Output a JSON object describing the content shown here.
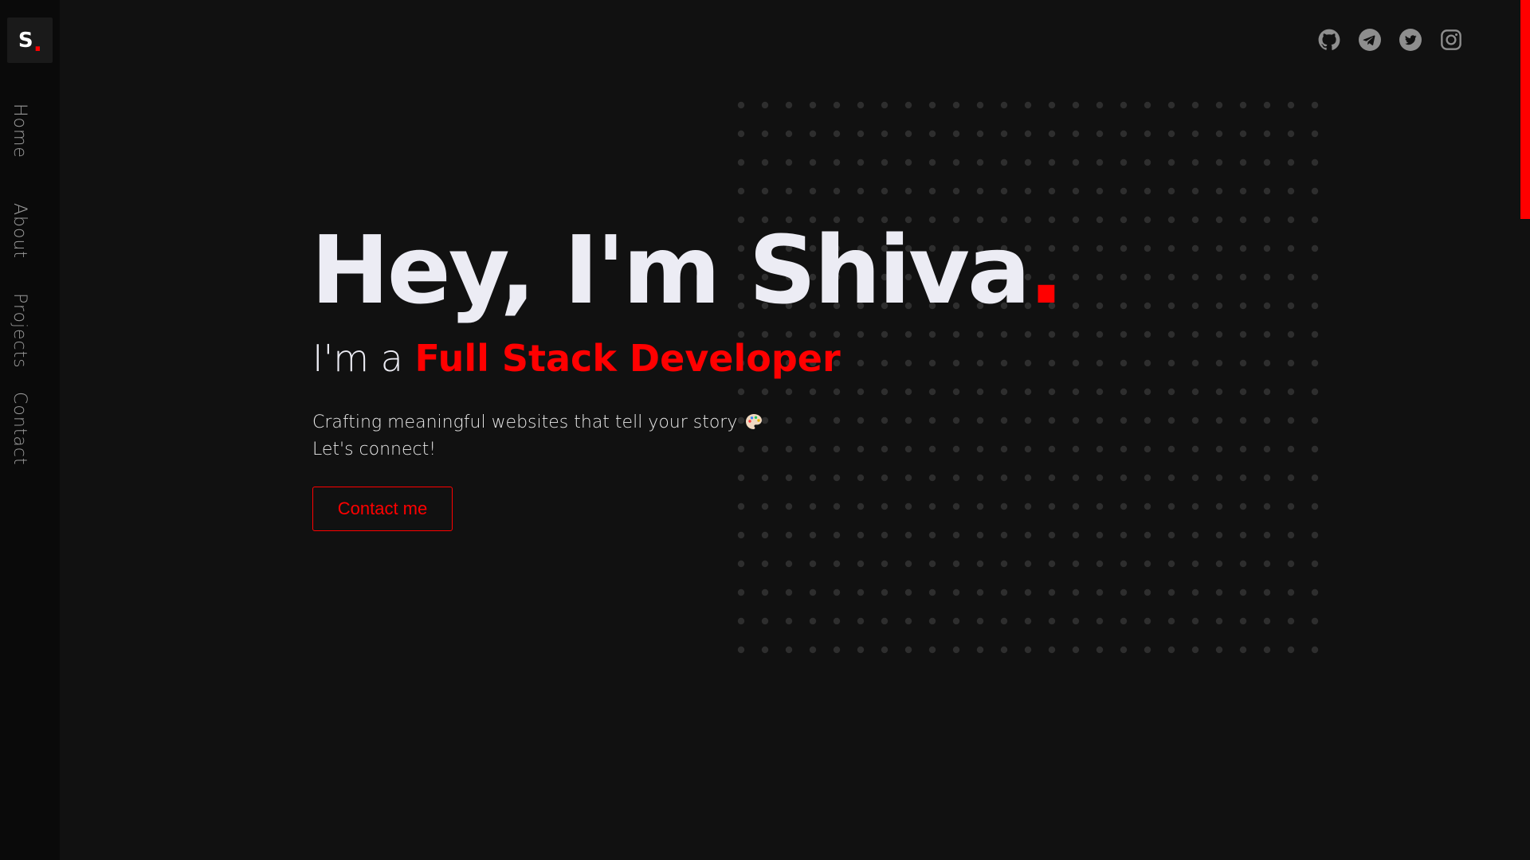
{
  "sidebar": {
    "logo": {
      "letter": "S",
      "dot": "."
    },
    "nav": [
      {
        "label": "Home"
      },
      {
        "label": "About"
      },
      {
        "label": "Projects"
      },
      {
        "label": "Contact"
      }
    ]
  },
  "socials": [
    {
      "icon": "github-icon"
    },
    {
      "icon": "telegram-icon"
    },
    {
      "icon": "twitter-icon"
    },
    {
      "icon": "instagram-icon"
    }
  ],
  "hero": {
    "greeting": "Hey, I'm Shiva",
    "greeting_dot": ".",
    "subtitle_prefix": "I'm a ",
    "role": "Full Stack Developer",
    "description_line1": "Crafting meaningful websites that tell your story",
    "description_emoji": "palette-icon",
    "description_line2": "Let's connect!",
    "button_label": "Contact me"
  },
  "colors": {
    "background": "#111111",
    "sidebar": "#0a0a0a",
    "accent": "#ff0000",
    "text": "#ececf4",
    "muted": "#9a9a9a",
    "dots": "#2e2e2e"
  }
}
